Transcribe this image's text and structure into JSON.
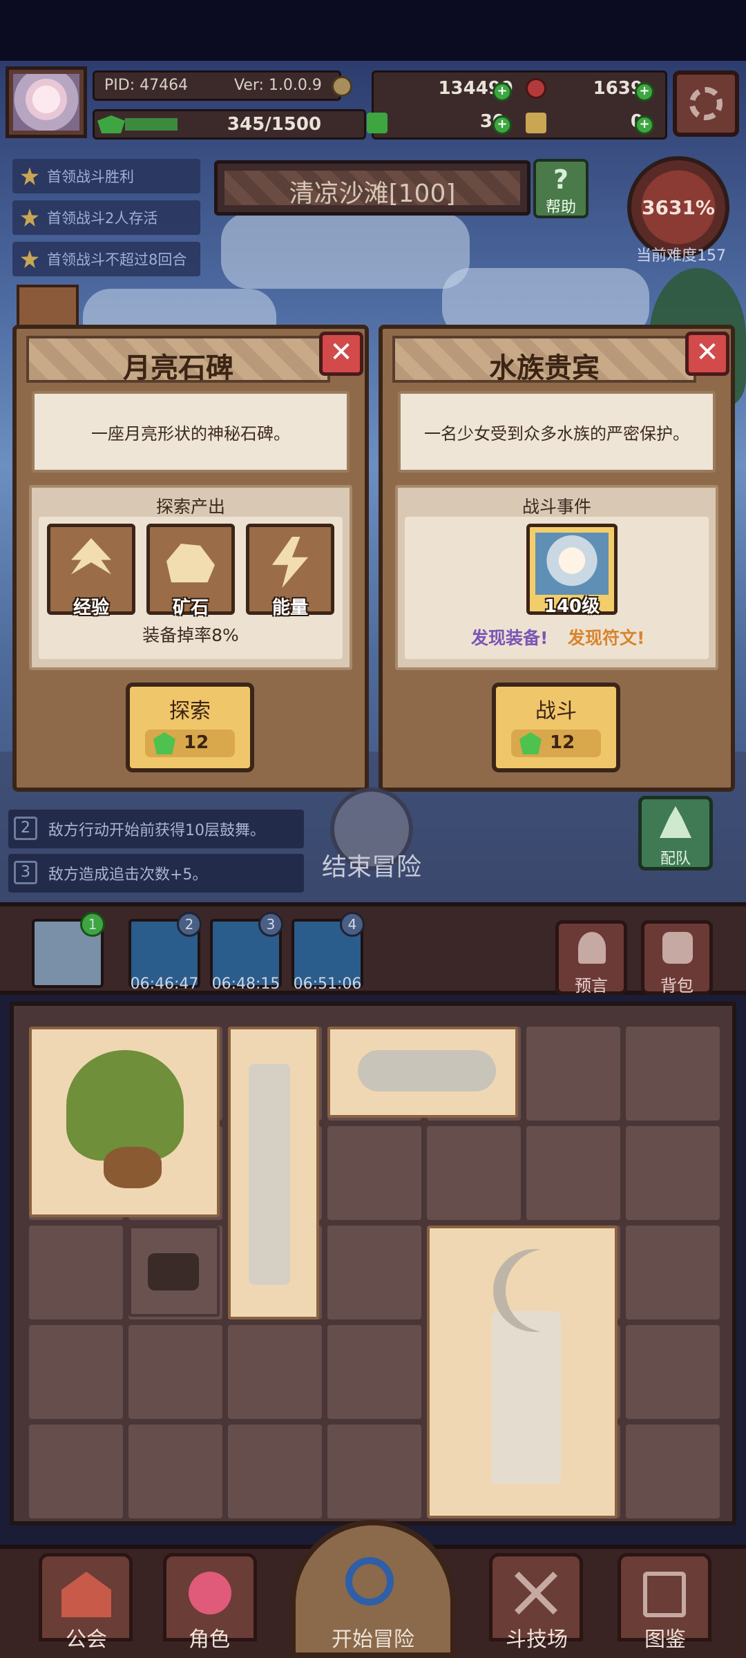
{
  "header": {
    "pid": "PID: 47464",
    "version": "Ver: 1.0.0.9",
    "exp": "345/1500",
    "gold": "134499",
    "gems": "1639",
    "clover": "30",
    "hammer": "0"
  },
  "quests": [
    "首领战斗胜利",
    "首领战斗2人存活",
    "首领战斗不超过8回合"
  ],
  "stage": {
    "title": "清凉沙滩[100]",
    "help": "帮助",
    "difficulty_pct": "3631%",
    "difficulty_label": "当前难度157"
  },
  "card_left": {
    "title": "月亮石碑",
    "description": "一座月亮形状的神秘石碑。",
    "section_title": "探索产出",
    "rewards": [
      "经验",
      "矿石",
      "能量"
    ],
    "note": "装备掉率8%",
    "action": "探索",
    "cost": "12"
  },
  "card_right": {
    "title": "水族贵宾",
    "description": "一名少女受到众多水族的严密保护。",
    "section_title": "战斗事件",
    "level": "140级",
    "find_equip": "发现装备!",
    "find_rune": "发现符文!",
    "action": "战斗",
    "cost": "12"
  },
  "effects": [
    {
      "num": "2",
      "text": "敌方行动开始前获得10层鼓舞。"
    },
    {
      "num": "3",
      "text": "敌方造成追击次数+5。"
    }
  ],
  "end_adventure": "结束冒险",
  "team": "配队",
  "slots": [
    {
      "num": "1",
      "time": ""
    },
    {
      "num": "2",
      "time": "06:46:47"
    },
    {
      "num": "3",
      "time": "06:48:15"
    },
    {
      "num": "4",
      "time": "06:51:06"
    }
  ],
  "side_buttons": {
    "prophecy": "预言",
    "bag": "背包"
  },
  "nav": [
    "公会",
    "角色",
    "开始冒险",
    "斗技场",
    "图鉴"
  ],
  "icons": {
    "avatar": "character-avatar-icon",
    "gear": "gear-icon",
    "close": "close-icon",
    "gem": "green-gem-icon",
    "star": "star-icon"
  },
  "colors": {
    "card_bg": "#8e6a4b",
    "button_gold": "#f0c66a",
    "close_red": "#d24a4a",
    "equip_purple": "#7b56b6",
    "rune_orange": "#d7842c",
    "plus_green": "#3ea640"
  }
}
